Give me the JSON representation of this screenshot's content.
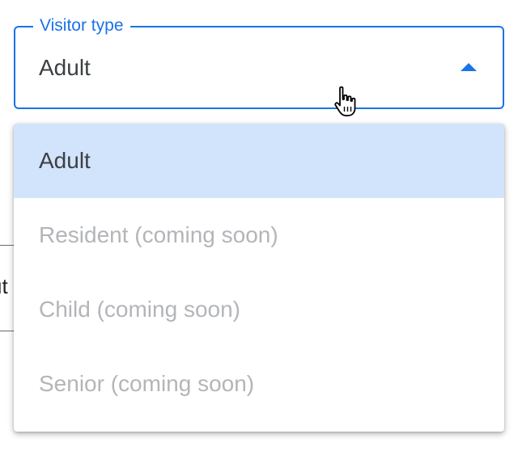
{
  "background": {
    "partial_text": "ut"
  },
  "field": {
    "label": "Visitor type",
    "value": "Adult"
  },
  "menu": {
    "items": [
      {
        "label": "Adult",
        "selected": true,
        "disabled": false
      },
      {
        "label": "Resident (coming soon)",
        "selected": false,
        "disabled": true
      },
      {
        "label": "Child (coming soon)",
        "selected": false,
        "disabled": true
      },
      {
        "label": "Senior (coming soon)",
        "selected": false,
        "disabled": true
      }
    ]
  },
  "icons": {
    "dropdown_arrow": "arrow-up-icon",
    "cursor": "hand-pointer-cursor-icon"
  },
  "colors": {
    "accent": "#1a73e8",
    "selected_bg": "#d2e3fc",
    "disabled_text": "#b3b5b8",
    "text": "#3c4043"
  }
}
